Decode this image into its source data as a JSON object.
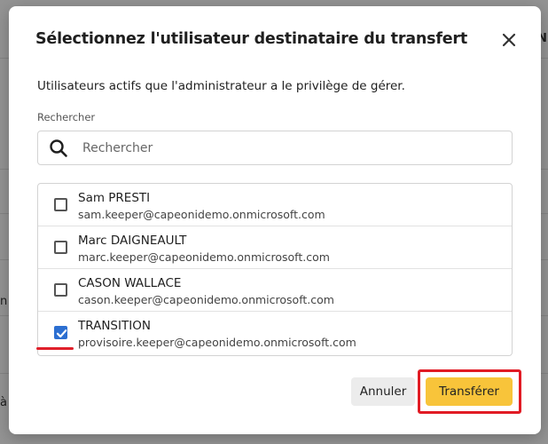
{
  "dialog": {
    "title": "Sélectionnez l'utilisateur destinataire du transfert",
    "subtitle": "Utilisateurs actifs que l'administrateur a le privilège de gérer.",
    "close_icon": "close-icon"
  },
  "search": {
    "label": "Rechercher",
    "placeholder": "Rechercher",
    "value": "",
    "icon": "search-icon"
  },
  "users": [
    {
      "name": "Sam PRESTI",
      "email": "sam.keeper@capeonidemo.onmicrosoft.com",
      "checked": false
    },
    {
      "name": "Marc DAIGNEAULT",
      "email": "marc.keeper@capeonidemo.onmicrosoft.com",
      "checked": false
    },
    {
      "name": "CASON WALLACE",
      "email": "cason.keeper@capeonidemo.onmicrosoft.com",
      "checked": false
    },
    {
      "name": "TRANSITION",
      "email": "provisoire.keeper@capeonidemo.onmicrosoft.com",
      "checked": true
    }
  ],
  "buttons": {
    "cancel": "Annuler",
    "transfer": "Transférer"
  },
  "background": {
    "fragments": [
      "N",
      "n",
      "à"
    ]
  },
  "colors": {
    "accent": "#2c6fd1",
    "primary_button": "#f8c43a",
    "annotation_red": "#e11b24"
  }
}
